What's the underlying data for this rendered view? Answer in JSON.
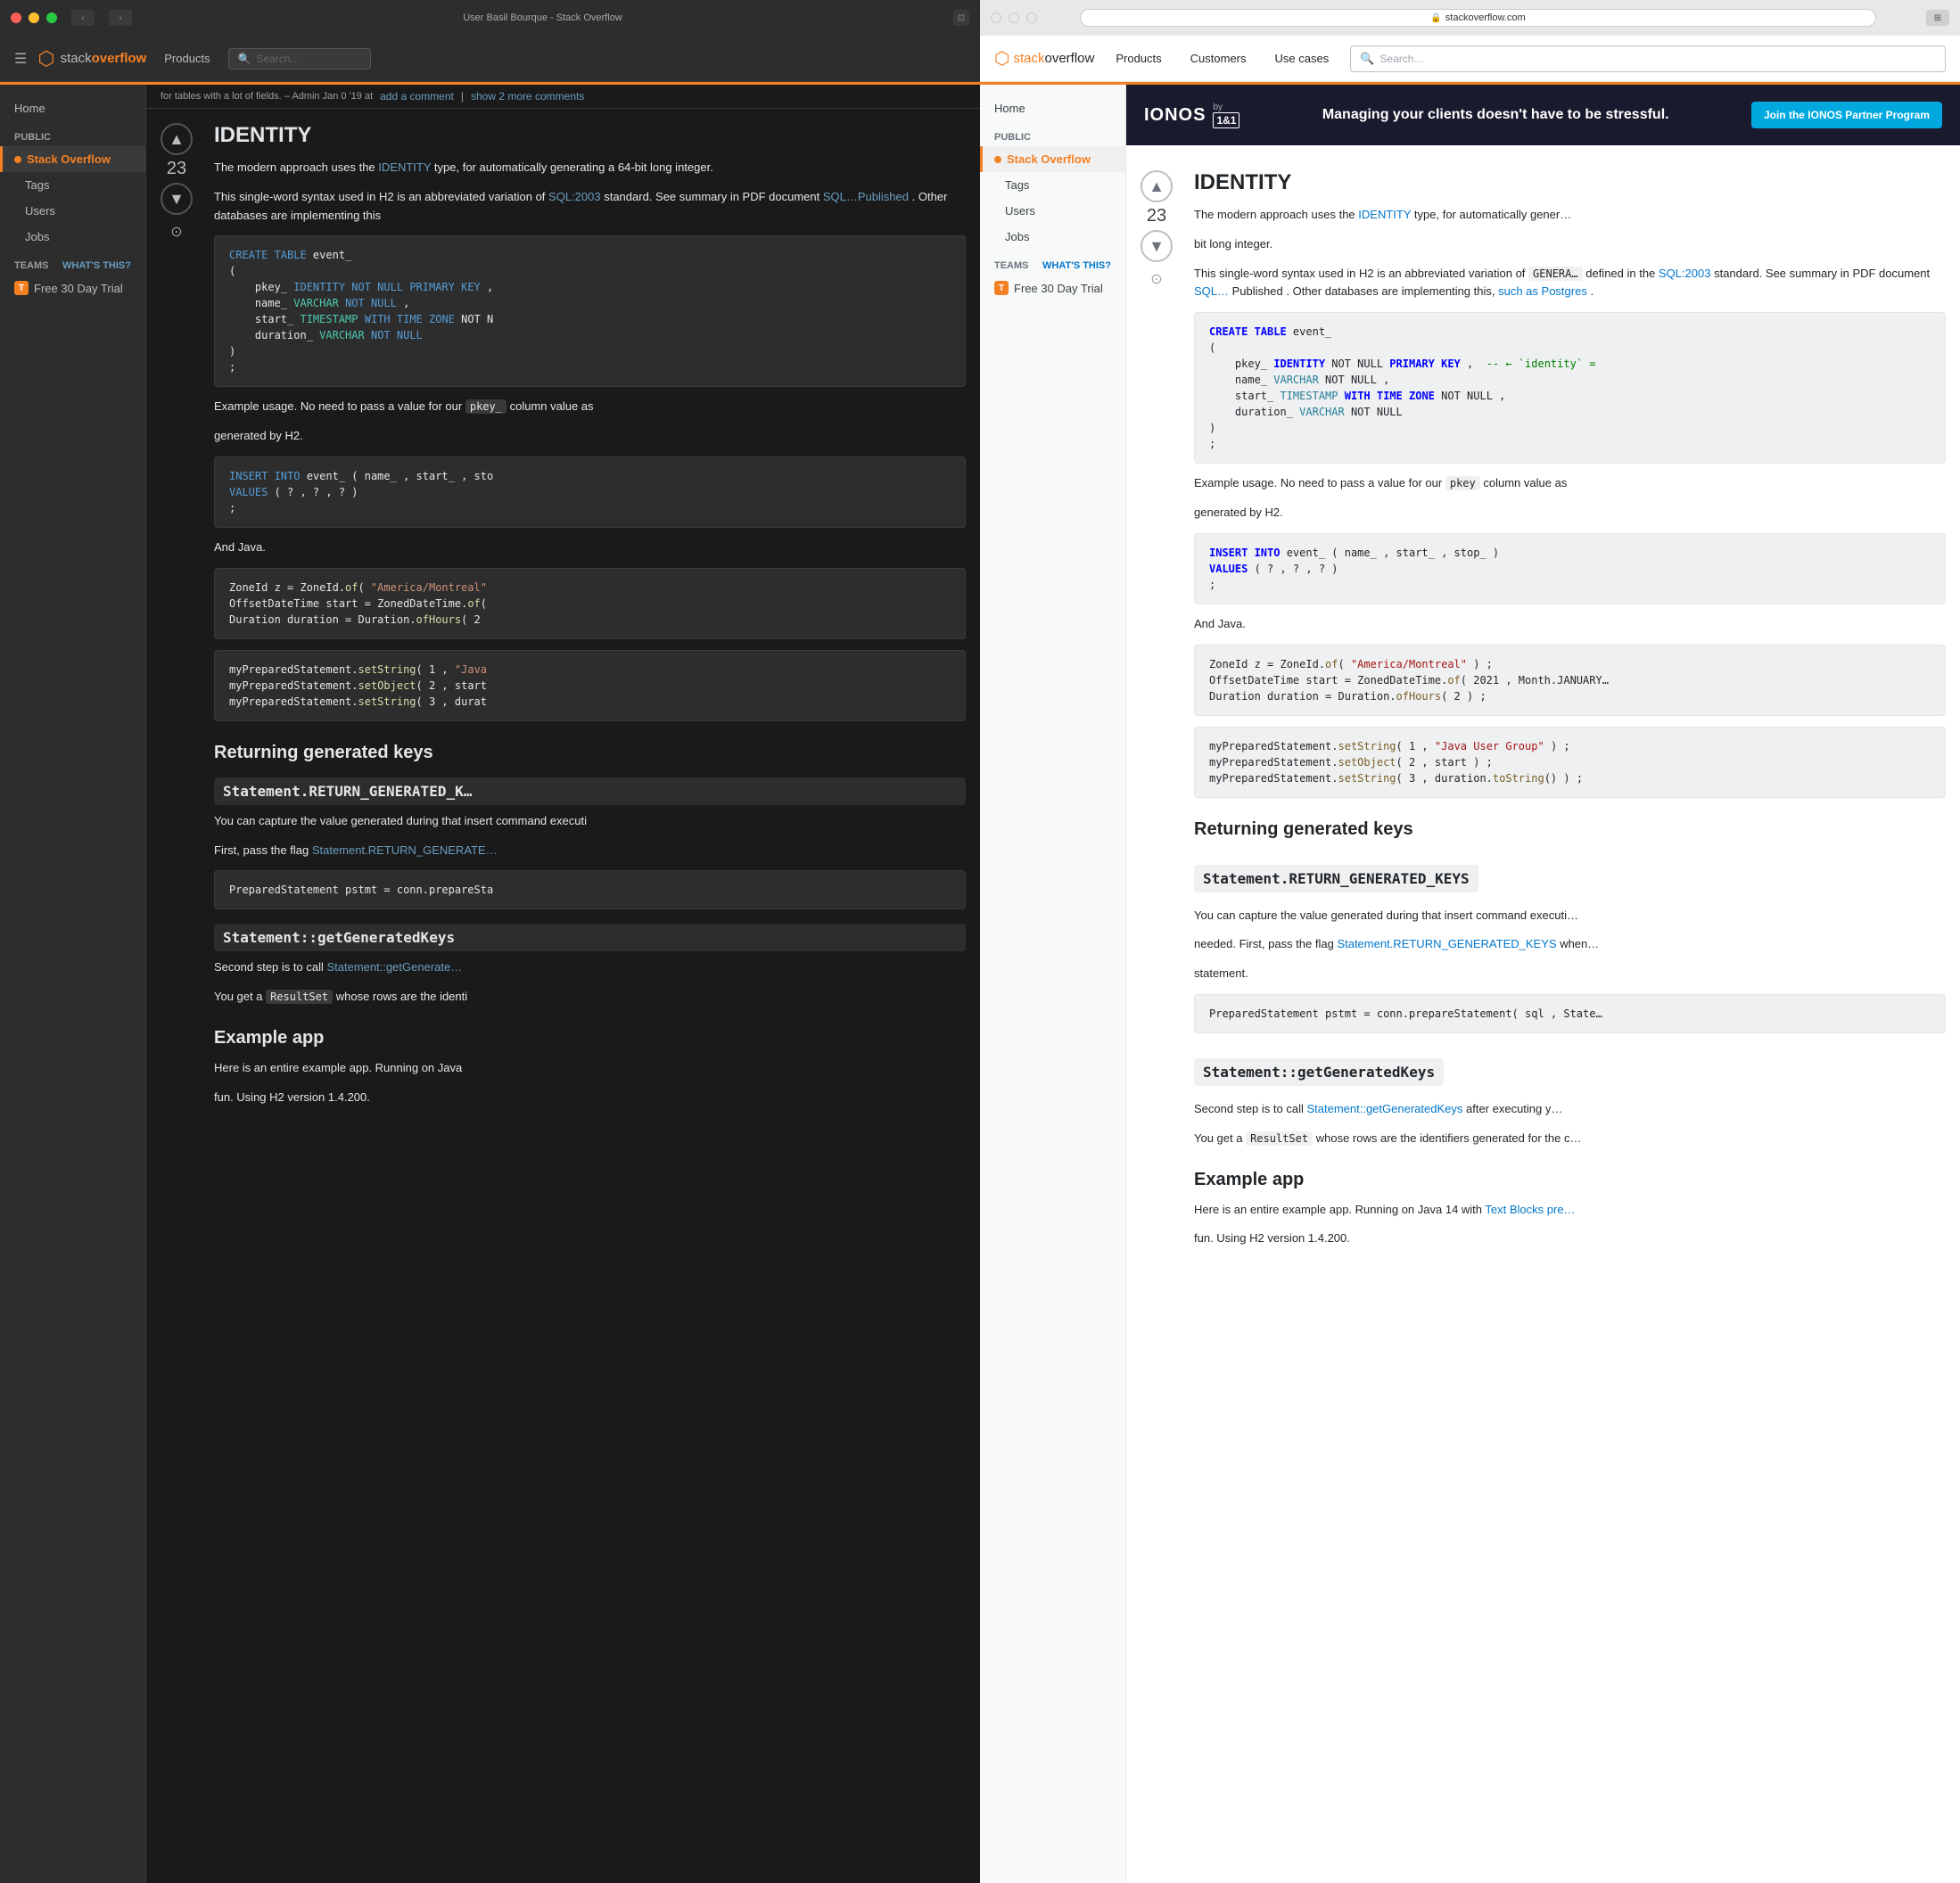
{
  "left": {
    "window_title": "User Basil Bourque - Stack Overflow",
    "nav": {
      "products_label": "Products",
      "search_placeholder": "Search…"
    },
    "sidebar": {
      "home": "Home",
      "public_label": "PUBLIC",
      "stack_overflow": "Stack Overflow",
      "tags": "Tags",
      "users": "Users",
      "jobs": "Jobs",
      "teams_label": "TEAMS",
      "whats_this": "What's this?",
      "free_trial": "Free 30 Day Trial"
    },
    "comments_bar": {
      "add_comment": "add a comment",
      "separator": "|",
      "show_comments": "show 2 more comments"
    },
    "answer": {
      "vote_count": "23",
      "heading": "IDENTITY",
      "text1": "The modern approach uses the ",
      "identity_link": "IDENTITY",
      "text1b": " type, for automatically generating a 64-bit long integer.",
      "text2": "This single-word syntax used in H2 is an abbreviated variation of ",
      "sql2003_link": "SQL:2003",
      "text2b": " standard. See summary in PDF document ",
      "sql_published_link": "SQL…Published",
      "text2c": ". Other databases are implementing this",
      "code1": {
        "lines": [
          "CREATE TABLE event_",
          "(",
          "    pkey_ IDENTITY NOT NULL PRIMARY KEY ,",
          "    name_ VARCHAR NOT NULL ,",
          "    start_ TIMESTAMP WITH TIME ZONE NOT N",
          "    duration_ VARCHAR NOT NULL",
          ")",
          ";"
        ]
      },
      "text3": "Example usage. No need to pass a value for our ",
      "pkey_code": "pkey_",
      "text3b": " column value as",
      "text3c": "generated by H2.",
      "code2": {
        "lines": [
          "INSERT INTO event_ ( name_ , start_ , sto",
          "VALUES ( ? , ? , ? )",
          ";"
        ]
      },
      "text4": "And Java.",
      "code3": {
        "lines": [
          "ZoneId z = ZoneId.of( \"America/Montreal\"",
          "OffsetDateTime start = ZonedDateTime.of(",
          "Duration duration = Duration.ofHours( 2"
        ]
      },
      "code4": {
        "lines": [
          "myPreparedStatement.setString( 1 , \"Java",
          "myPreparedStatement.setObject( 2 , start",
          "myPreparedStatement.setString( 3 , durat"
        ]
      },
      "returning_keys_heading": "Returning generated keys",
      "return_subheading": "Statement.RETURN_GENERATED_K…",
      "text5": "You can capture the value generated during that insert command executi",
      "text6": "First, pass the flag ",
      "statement_link": "Statement.RETURN_GENERATE…",
      "code5": "PreparedStatement pstmt = conn.prepareSta",
      "getkeys_subheading": "Statement::getGeneratedKeys",
      "text7": "Second step is to call ",
      "getkeys_link": "Statement::getGenerate…",
      "text8": "You get a ",
      "result_set_code": "ResultSet",
      "text9": " whose rows are the identi",
      "example_app_heading": "Example app",
      "text10": "Here is an entire example app. Running on Java",
      "text11": "fun. Using H2 version 1.4.200."
    }
  },
  "right": {
    "url": "stackoverflow.com",
    "nav": {
      "products_label": "Products",
      "customers_label": "Customers",
      "use_cases_label": "Use cases",
      "search_placeholder": "Search…"
    },
    "sidebar": {
      "home": "Home",
      "public_label": "PUBLIC",
      "stack_overflow": "Stack Overflow",
      "tags": "Tags",
      "users": "Users",
      "jobs": "Jobs",
      "teams_label": "TEAMS",
      "whats_this": "What's this?",
      "free_trial": "Free 30 Day Trial"
    },
    "banner": {
      "logo_text": "IONOS",
      "by_text": "by",
      "one_text": "1&1",
      "main_text": "Managing your clients doesn't have to be stressful.",
      "btn_text": "Join the IONOS Partner Program"
    },
    "answer": {
      "vote_count": "23",
      "heading": "IDENTITY",
      "text1": "The modern approach uses the ",
      "identity_link": "IDENTITY",
      "text1b": " type, for automatically gener…",
      "text1c": "bit long integer.",
      "text2": "This single-word syntax used in H2 is an abbreviated variation of ",
      "genera_code": "GENERA…",
      "text2b": " defined in the ",
      "sql2003_link": "SQL:2003",
      "text2c": " standard. See summary in PDF document ",
      "sql_link": "SQL…",
      "text2d": "Published",
      "text2e": ". Other databases are implementing this, ",
      "postgres_link": "such as Postgres",
      "text2f": ".",
      "code1": {
        "lines": [
          "CREATE TABLE event_",
          "(",
          "    pkey_ IDENTITY NOT NULL PRIMARY KEY ,  -- ← `identity` =",
          "    name_ VARCHAR NOT NULL ,",
          "    start_ TIMESTAMP WITH TIME ZONE NOT NULL ,",
          "    duration_ VARCHAR NOT NULL",
          ")",
          ";"
        ]
      },
      "text3": "Example usage. No need to pass a value for our ",
      "pkey_code": "pkey",
      "text3b": " column value as",
      "text3c": "generated by H2.",
      "code2": {
        "lines": [
          "INSERT INTO event_ ( name_ , start_ , stop_ )",
          "VALUES ( ? , ? , ? )",
          ";"
        ]
      },
      "text4": "And Java.",
      "code3": {
        "lines": [
          "ZoneId z = ZoneId.of( \"America/Montreal\" ) ;",
          "OffsetDateTime start = ZonedDateTime.of( 2021 , Month.JANUARY…",
          "Duration duration = Duration.ofHours( 2 ) ;"
        ]
      },
      "code4": {
        "lines": [
          "myPreparedStatement.setString( 1 , \"Java User Group\" ) ;",
          "myPreparedStatement.setObject( 2 , start ) ;",
          "myPreparedStatement.setString( 3 , duration.toString() ) ;"
        ]
      },
      "returning_keys_heading": "Returning generated keys",
      "return_subheading": "Statement.RETURN_GENERATED_KEYS",
      "text5": "You can capture the value generated during that insert command executi…",
      "text6": "needed. First, pass the flag ",
      "statement_link": "Statement.RETURN_GENERATED_KEYS",
      "text6b": " when…",
      "text6c": "statement.",
      "code5": "PreparedStatement pstmt = conn.prepareStatement( sql , State…",
      "getkeys_subheading": "Statement::getGeneratedKeys",
      "text7": "Second step is to call ",
      "getkeys_link": "Statement::getGeneratedKeys",
      "text7b": " after executing y…",
      "text8": "You get a ",
      "result_set_code": "ResultSet",
      "text9": " whose rows are the identifiers generated for the c…",
      "example_app_heading": "Example app",
      "text10": "Here is an entire example app. Running on Java 14 with ",
      "text_blocks_link": "Text Blocks pre…",
      "text11": "fun. Using H2 version 1.4.200."
    }
  }
}
